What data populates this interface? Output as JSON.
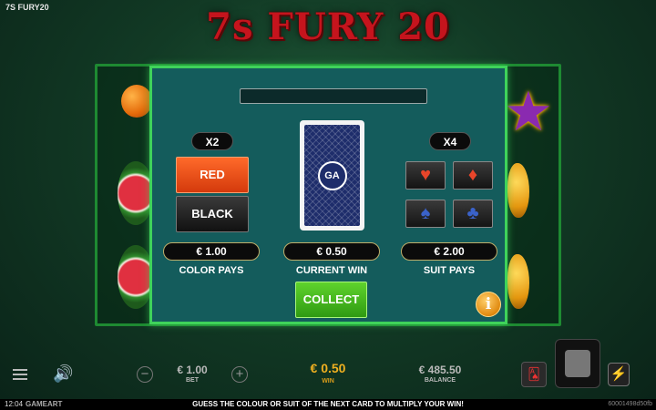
{
  "game": {
    "label": "7S FURY20",
    "logo": "7s FURY 20"
  },
  "gamble": {
    "color_multiplier": "X2",
    "suit_multiplier": "X4",
    "red_label": "RED",
    "black_label": "BLACK",
    "color_pays_value": "€ 1.00",
    "color_pays_label": "COLOR PAYS",
    "current_win_value": "€ 0.50",
    "current_win_label": "CURRENT WIN",
    "suit_pays_value": "€ 2.00",
    "suit_pays_label": "SUIT PAYS",
    "collect_label": "COLLECT",
    "info_label": "i",
    "card_logo": "GA",
    "suits": [
      {
        "name": "hearts",
        "glyph": "♥",
        "color": "#e8452a"
      },
      {
        "name": "diamonds",
        "glyph": "♦",
        "color": "#e8452a"
      },
      {
        "name": "spades",
        "glyph": "♠",
        "color": "#3a62c9"
      },
      {
        "name": "clubs",
        "glyph": "♣",
        "color": "#3a62c9"
      }
    ]
  },
  "bottom": {
    "bet_value": "€ 1.00",
    "bet_label": "BET",
    "win_value": "€ 0.50",
    "win_label": "WIN",
    "balance_value": "€ 485.50",
    "balance_label": "BALANCE",
    "minus": "−",
    "plus": "+"
  },
  "footer": {
    "clock": "12:04",
    "brand": "GAMEART",
    "message": "GUESS THE COLOUR OR SUIT OF THE NEXT CARD TO MULTIPLY YOUR WIN!",
    "game_id": "60001498d50fb"
  },
  "colors": {
    "panel_border": "#3fd35a",
    "win_accent": "#f0b020",
    "logo_red": "#c5141d"
  }
}
